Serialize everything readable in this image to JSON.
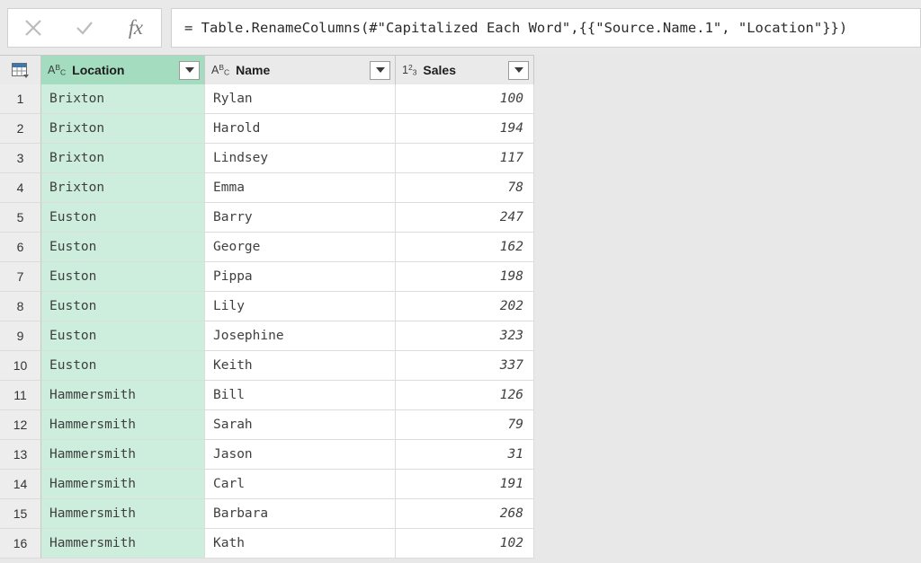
{
  "formula_bar": {
    "cancel_icon": "close-x-icon",
    "accept_icon": "checkmark-icon",
    "fx_label": "fx",
    "formula": "= Table.RenameColumns(#\"Capitalized Each Word\",{{\"Source.Name.1\", \"Location\"}})"
  },
  "grid": {
    "corner_icon": "table-grid-icon",
    "columns": [
      {
        "label": "Location",
        "type_icon": "abc-text-type-icon",
        "type_marks": [
          "A",
          "B",
          "C"
        ],
        "selected": true
      },
      {
        "label": "Name",
        "type_icon": "abc-text-type-icon",
        "type_marks": [
          "A",
          "B",
          "C"
        ],
        "selected": false
      },
      {
        "label": "Sales",
        "type_icon": "123-number-type-icon",
        "type_marks": [
          "1",
          "2",
          "3"
        ],
        "selected": false
      }
    ],
    "filter_icon": "chevron-down-icon",
    "rows": [
      {
        "num": "1",
        "location": "Brixton",
        "name": "Rylan",
        "sales": "100"
      },
      {
        "num": "2",
        "location": "Brixton",
        "name": "Harold",
        "sales": "194"
      },
      {
        "num": "3",
        "location": "Brixton",
        "name": "Lindsey",
        "sales": "117"
      },
      {
        "num": "4",
        "location": "Brixton",
        "name": "Emma",
        "sales": "78"
      },
      {
        "num": "5",
        "location": "Euston",
        "name": "Barry",
        "sales": "247"
      },
      {
        "num": "6",
        "location": "Euston",
        "name": "George",
        "sales": "162"
      },
      {
        "num": "7",
        "location": "Euston",
        "name": "Pippa",
        "sales": "198"
      },
      {
        "num": "8",
        "location": "Euston",
        "name": "Lily",
        "sales": "202"
      },
      {
        "num": "9",
        "location": "Euston",
        "name": "Josephine",
        "sales": "323"
      },
      {
        "num": "10",
        "location": "Euston",
        "name": "Keith",
        "sales": "337"
      },
      {
        "num": "11",
        "location": "Hammersmith",
        "name": "Bill",
        "sales": "126"
      },
      {
        "num": "12",
        "location": "Hammersmith",
        "name": "Sarah",
        "sales": "79"
      },
      {
        "num": "13",
        "location": "Hammersmith",
        "name": "Jason",
        "sales": "31"
      },
      {
        "num": "14",
        "location": "Hammersmith",
        "name": "Carl",
        "sales": "191"
      },
      {
        "num": "15",
        "location": "Hammersmith",
        "name": "Barbara",
        "sales": "268"
      },
      {
        "num": "16",
        "location": "Hammersmith",
        "name": "Kath",
        "sales": "102"
      }
    ]
  },
  "colors": {
    "selected_header_green": "#a3dcbe",
    "selected_cell_green": "#cdeedd",
    "page_background": "#e8e8e8",
    "header_gray": "#eaeaea"
  }
}
